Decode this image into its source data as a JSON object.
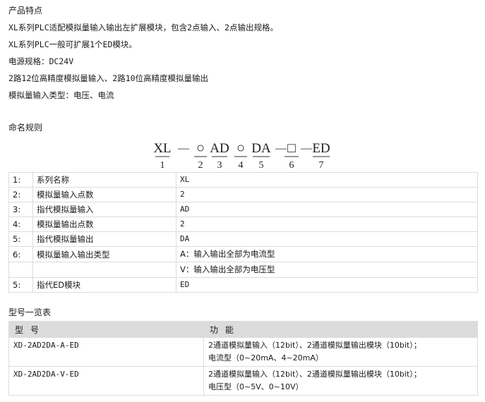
{
  "features": {
    "title": "产品特点",
    "lines": [
      "XL系列PLC适配模拟量输入输出左扩展模块，包含2点输入、2点输出规格。",
      "XL系列PLC一般可扩展1个ED模块。",
      "电源规格：DC24V",
      "2路12位高精度模拟量输入、2路10位高精度模拟量输出",
      "模拟量输入类型：电压、电流"
    ]
  },
  "naming": {
    "title": "命名规则",
    "parts": [
      "XL",
      "—",
      "○",
      "AD",
      "○",
      "DA",
      "—",
      "□",
      "—",
      "ED"
    ],
    "indices": [
      "1",
      "2",
      "3",
      "4",
      "5",
      "6",
      "7"
    ]
  },
  "rules": {
    "rows": [
      {
        "no": "1:",
        "name": "系列名称",
        "value": "XL"
      },
      {
        "no": "2:",
        "name": "模拟量输入点数",
        "value": "2"
      },
      {
        "no": "3:",
        "name": "指代模拟量输入",
        "value": "AD"
      },
      {
        "no": "4:",
        "name": "模拟量输出点数",
        "value": "2"
      },
      {
        "no": "5:",
        "name": "指代模拟量输出",
        "value": "DA"
      },
      {
        "no": "6:",
        "name": "模拟量输入输出类型",
        "value": "A：输入输出全部为电流型"
      },
      {
        "no": "",
        "name": "",
        "value": "V：输入输出全部为电压型"
      },
      {
        "no": "5:",
        "name": "指代ED模块",
        "value": "ED"
      }
    ]
  },
  "models": {
    "title": "型号一览表",
    "header": {
      "model": "型号",
      "function": "功能"
    },
    "rows": [
      {
        "model": "XD-2AD2DA-A-ED",
        "func1": "2通道模拟量输入（12bit）、2通道模拟量输出模块（10bit）；",
        "func2": "电流型（0~20mA、4~20mA）"
      },
      {
        "model": "XD-2AD2DA-V-ED",
        "func1": "2通道模拟量输入（12bit）、2通道模拟量输出模块（10bit）；",
        "func2": "电压型（0~5V、0~10V）"
      }
    ]
  }
}
